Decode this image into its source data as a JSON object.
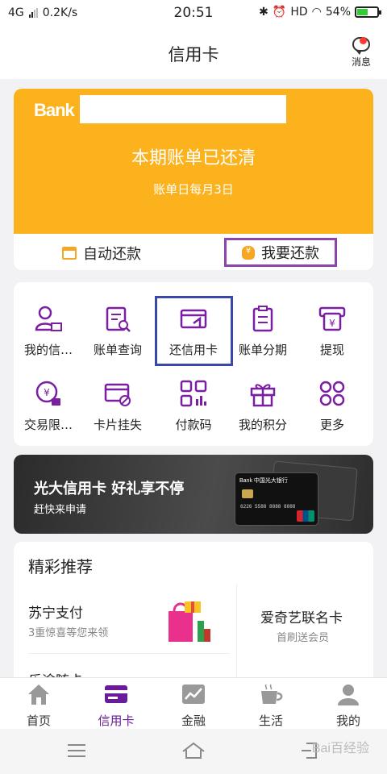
{
  "status_bar": {
    "network": "4G",
    "speed": "0.2K/s",
    "time": "20:51",
    "hd": "HD",
    "battery": "54%",
    "battery_level": 0.54
  },
  "header": {
    "title": "信用卡",
    "messages_label": "消息"
  },
  "card": {
    "bank_logo": "Bank",
    "status": "本期账单已还清",
    "billing_day": "账单日每月3日",
    "auto_repay": "自动还款",
    "repay_now": "我要还款",
    "accent_color": "#fcb21d"
  },
  "services": [
    {
      "label": "我的信…",
      "icon": "user-card-icon"
    },
    {
      "label": "账单查询",
      "icon": "bill-search-icon"
    },
    {
      "label": "还信用卡",
      "icon": "card-repay-icon"
    },
    {
      "label": "账单分期",
      "icon": "bill-installment-icon"
    },
    {
      "label": "提现",
      "icon": "withdraw-icon"
    },
    {
      "label": "交易限…",
      "icon": "transaction-limit-icon"
    },
    {
      "label": "卡片挂失",
      "icon": "card-lost-icon"
    },
    {
      "label": "付款码",
      "icon": "payment-code-icon"
    },
    {
      "label": "我的积分",
      "icon": "points-gift-icon"
    },
    {
      "label": "更多",
      "icon": "more-icon"
    }
  ],
  "banner": {
    "title": "光大信用卡 好礼享不停",
    "subtitle": "赶快来申请",
    "card_bank": "Bank 中国光大银行",
    "card_number": "6226 5588 8888 8888"
  },
  "recommend": {
    "title": "精彩推荐",
    "items": [
      {
        "title": "苏宁支付",
        "subtitle": "3重惊喜等您来领"
      },
      {
        "title": "爱奇艺联名卡",
        "subtitle": "首刷送会员"
      },
      {
        "title": "乐途随卡"
      }
    ]
  },
  "tabbar": {
    "items": [
      {
        "label": "首页",
        "icon": "home-icon"
      },
      {
        "label": "信用卡",
        "icon": "credit-card-icon"
      },
      {
        "label": "金融",
        "icon": "finance-chart-icon"
      },
      {
        "label": "生活",
        "icon": "coffee-cup-icon"
      },
      {
        "label": "我的",
        "icon": "person-icon"
      }
    ],
    "active_index": 1,
    "active_color": "#6a1b9a"
  },
  "watermark": "Bai百经验"
}
